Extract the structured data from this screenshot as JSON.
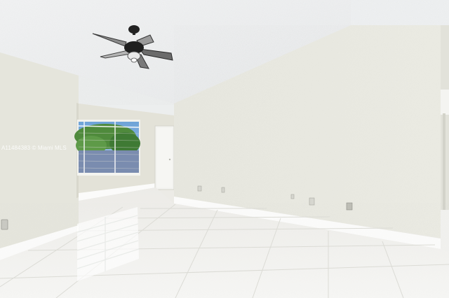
{
  "photo": {
    "subject": "empty-room-interior",
    "watermark": "A11484383 © Miami MLS"
  },
  "fixtures": {
    "ceiling_fan_icon": "ceiling-fan-icon",
    "door_icon": "door-icon",
    "window_icon": "window-icon",
    "outlet_icon": "outlet-icon"
  }
}
